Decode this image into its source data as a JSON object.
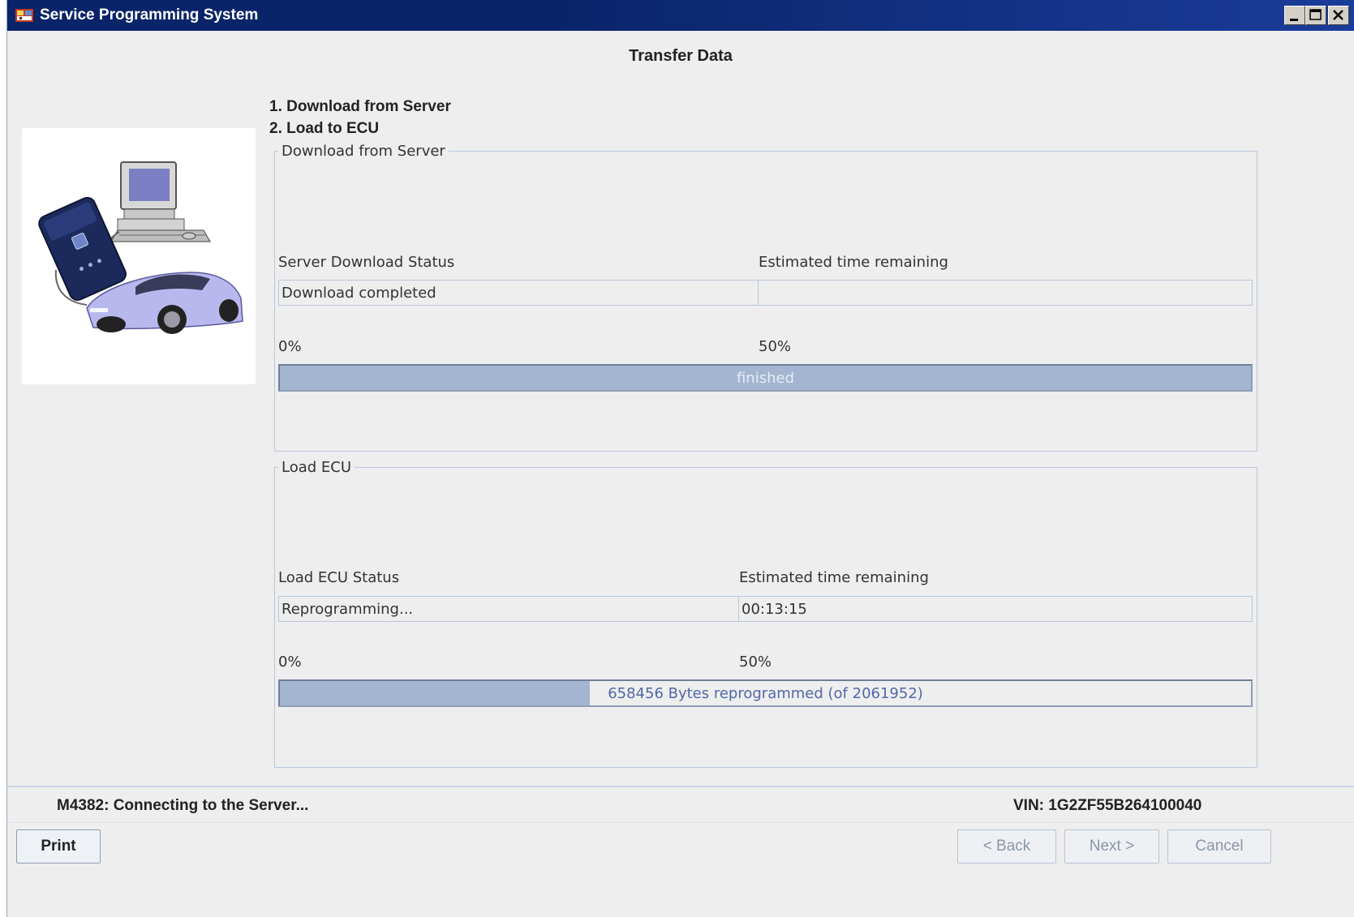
{
  "window": {
    "title": "Service Programming System"
  },
  "page": {
    "heading": "Transfer Data",
    "steps": [
      "1. Download from Server",
      "2. Load to ECU"
    ]
  },
  "download_group": {
    "legend": "Download from Server",
    "status_label": "Server Download Status",
    "time_label": "Estimated time remaining",
    "status_value": "Download completed",
    "time_value": "",
    "progress_min_label": "0%",
    "progress_mid_label": "50%",
    "progress_text": "finished",
    "progress_percent": 100
  },
  "ecu_group": {
    "legend": "Load ECU",
    "status_label": "Load ECU Status",
    "time_label": "Estimated time remaining",
    "status_value": "Reprogramming...",
    "time_value": "00:13:15",
    "progress_min_label": "0%",
    "progress_mid_label": "50%",
    "progress_text": "658456 Bytes reprogrammed (of 2061952)",
    "progress_percent": 31.93
  },
  "statusbar": {
    "message": "M4382: Connecting to the Server...",
    "vin": "VIN: 1G2ZF55B264100040"
  },
  "buttons": {
    "print": "Print",
    "back": "< Back",
    "next": "Next >",
    "cancel": "Cancel"
  },
  "colors": {
    "titlebar": "#0a246a",
    "progress_fill": "#a3b5d0",
    "progress_text_on_fill": "#e6ecf5",
    "progress_text": "#5068a8",
    "group_border": "#b8c7dc"
  },
  "icons": {
    "app": "sps-app-icon",
    "minimize": "minimize-icon",
    "maximize": "maximize-icon",
    "close": "close-icon"
  }
}
